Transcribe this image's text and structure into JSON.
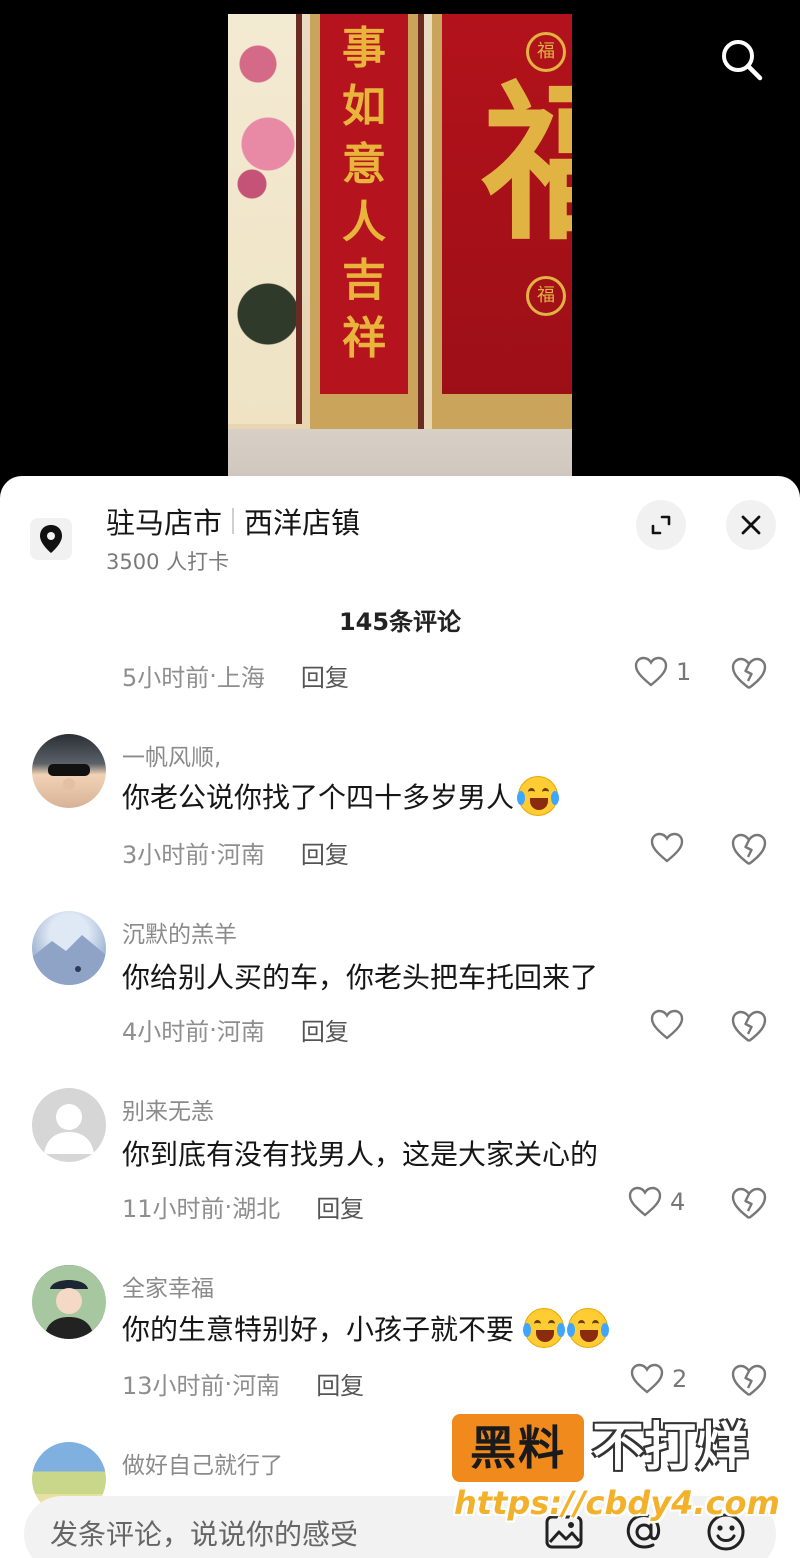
{
  "video": {
    "couplet_chars": [
      "事",
      "如",
      "意",
      "人",
      "吉",
      "祥"
    ],
    "fu_char": "福",
    "seal_char": "福",
    "search_icon": "search-icon"
  },
  "location": {
    "city": "驻马店市",
    "town": "西洋店镇",
    "checkins": "3500 人打卡",
    "icon": "map-pin-icon",
    "expand_icon": "expand-icon",
    "close_icon": "close-icon"
  },
  "comment_count": "145条评论",
  "partial_comment": {
    "time": "5小时前",
    "sep": " · ",
    "region": "上海",
    "reply": "回复",
    "likes": "1"
  },
  "comments": [
    {
      "user": "一帆风顺,",
      "text": "你老公说你找了个四十多岁男人",
      "emoji_count": 1,
      "time": "3小时前",
      "region": "河南",
      "reply": "回复",
      "likes": ""
    },
    {
      "user": "沉默的羔羊",
      "text": "你给别人买的车，你老头把车托回来了",
      "emoji_count": 0,
      "time": "4小时前",
      "region": "河南",
      "reply": "回复",
      "likes": ""
    },
    {
      "user": "别来无恙",
      "text": "你到底有没有找男人，这是大家关心的",
      "emoji_count": 0,
      "time": "11小时前",
      "region": "湖北",
      "reply": "回复",
      "likes": "4"
    },
    {
      "user": "全家幸福",
      "text": "你的生意特别好，小孩子就不要",
      "emoji_count": 2,
      "time": "13小时前",
      "region": "河南",
      "reply": "回复",
      "likes": "2"
    },
    {
      "user": "做好自己就行了",
      "text": "",
      "emoji_count": 0,
      "time": "",
      "region": "",
      "reply": "",
      "likes": ""
    }
  ],
  "input": {
    "placeholder": "发条评论，说说你的感受",
    "icons": [
      "image-icon",
      "at-icon",
      "emoji-icon"
    ]
  },
  "watermark": {
    "box": "黑料",
    "text": "不打烊",
    "url": "https://cbdy4.com"
  },
  "colors": {
    "couplet_red": "#b5141e",
    "gold": "#e0b343",
    "watermark_orange": "#f08a1c"
  }
}
